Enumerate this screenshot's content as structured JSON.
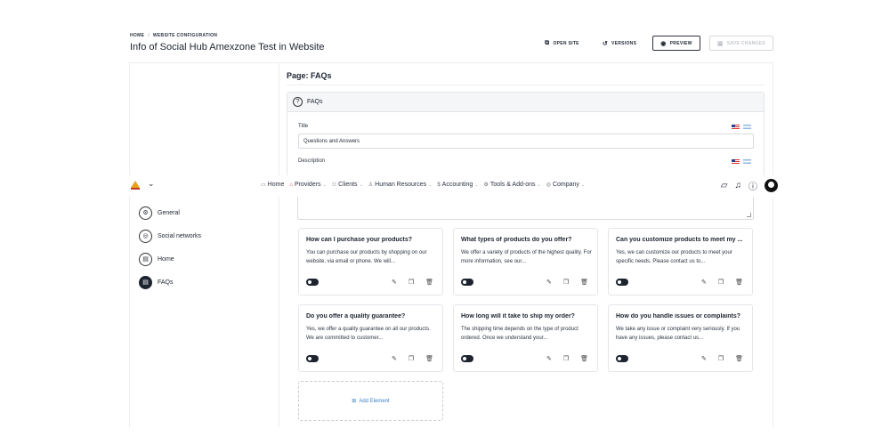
{
  "breadcrumb": {
    "home": "HOME",
    "separator": "/",
    "current": "WEBSITE CONFIGURATION"
  },
  "page_title": "Info of Social Hub Amexzone Test in Website",
  "header_actions": {
    "open_site": "OPEN SITE",
    "versions": "VERSIONS",
    "preview": "PREVIEW",
    "save_changes": "SAVE CHANGES"
  },
  "navbar": {
    "items": [
      {
        "label": "Home",
        "icon": "monitor-icon"
      },
      {
        "label": "Providers",
        "icon": "store-icon"
      },
      {
        "label": "Clients",
        "icon": "users-icon"
      },
      {
        "label": "Human Resources",
        "icon": "person-icon"
      },
      {
        "label": "Accounting",
        "icon": "dollar-icon"
      },
      {
        "label": "Tools & Add-ons",
        "icon": "gear-icon"
      },
      {
        "label": "Company",
        "icon": "company-icon"
      }
    ]
  },
  "sidebar": {
    "items": [
      {
        "label": "General",
        "icon": "gear-icon",
        "active": false
      },
      {
        "label": "Social networks",
        "icon": "instagram-icon",
        "active": false
      },
      {
        "label": "Home",
        "icon": "document-icon",
        "active": false
      },
      {
        "label": "FAQs",
        "icon": "document-icon",
        "active": true
      }
    ]
  },
  "content": {
    "page_label": "Page: FAQs",
    "section_title": "FAQs",
    "title_label": "Title",
    "title_value": "Questions and Answers",
    "description_label": "Description"
  },
  "cards": [
    {
      "question": "How can I purchase your products?",
      "answer": "You can purchase our products by shopping on our website, via email or phone. We will..."
    },
    {
      "question": "What types of products do you offer?",
      "answer": "We offer a variety of products of the highest quality. For more information, see our..."
    },
    {
      "question": "Can you customize products to meet my ...",
      "answer": "Yes, we can customize our products to meet your specific needs. Please contact us to..."
    },
    {
      "question": "Do you offer a quality guarantee?",
      "answer": "Yes, we offer a quality guarantee on all our products. We are committed to customer..."
    },
    {
      "question": "How long will it take to ship my order?",
      "answer": "The shipping time depends on the type of product ordered. Once we understand your..."
    },
    {
      "question": "How do you handle issues or complaints?",
      "answer": "We take any issue or complaint very seriously. If you have any issues, please contact us..."
    }
  ],
  "add_element": "Add Element",
  "colors": {
    "accent_dark": "#1d2430",
    "link_blue": "#3a82c4"
  }
}
